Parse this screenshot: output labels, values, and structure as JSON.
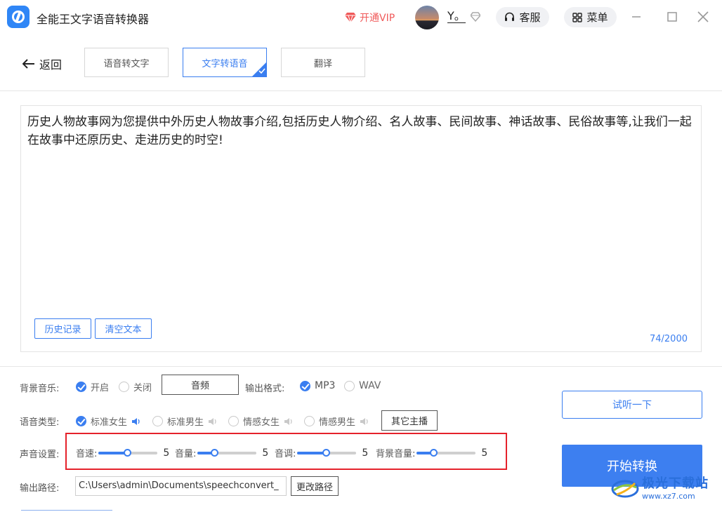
{
  "titlebar": {
    "app_title": "全能王文字语音转换器",
    "vip_label": "开通VIP",
    "user_name": "Y。",
    "service_label": "客服",
    "menu_label": "菜单",
    "icons": {
      "vip": "gem-icon",
      "service": "headset-icon",
      "menu": "grid-icon",
      "minimize": "minimize-icon",
      "maximize": "maximize-icon",
      "close": "close-icon"
    }
  },
  "nav": {
    "back_label": "返回",
    "tabs": [
      {
        "label": "语音转文字",
        "active": false
      },
      {
        "label": "文字转语音",
        "active": true
      },
      {
        "label": "翻译",
        "active": false
      }
    ]
  },
  "editor": {
    "text": "历史人物故事网为您提供中外历史人物故事介绍,包括历史人物介绍、名人故事、民间故事、神话故事、民俗故事等,让我们一起在故事中还原历史、走进历史的时空!",
    "history_button": "历史记录",
    "clear_button": "清空文本",
    "counter": "74/2000"
  },
  "settings": {
    "bg_music": {
      "label": "背景音乐:",
      "on_label": "开启",
      "off_label": "关闭",
      "selected": "on",
      "audio_button": "音频"
    },
    "output_format": {
      "label": "输出格式:",
      "options": [
        "MP3",
        "WAV"
      ],
      "selected": "MP3"
    },
    "voice_type": {
      "label": "语音类型:",
      "options": [
        "标准女生",
        "标准男生",
        "情感女生",
        "情感男生"
      ],
      "selected": "标准女生",
      "other_button": "其它主播"
    },
    "sound": {
      "label": "声音设置:",
      "sliders": [
        {
          "label": "音速:",
          "value": "5",
          "fraction": 0.5
        },
        {
          "label": "音量:",
          "value": "5",
          "fraction": 0.3
        },
        {
          "label": "音调:",
          "value": "5",
          "fraction": 0.5
        },
        {
          "label": "背景音量:",
          "value": "5",
          "fraction": 0.3
        }
      ]
    },
    "output_path": {
      "label": "输出路径:",
      "value": "C:\\Users\\admin\\Documents\\speechconvert_",
      "change_button": "更改路径"
    },
    "preview_button": "试听一下",
    "convert_button": "开始转换"
  },
  "watermark": {
    "main": "极光下载站",
    "sub": "www.xz7.com"
  },
  "colors": {
    "accent": "#3a7ef0",
    "vip": "#f05a5a",
    "highlight": "#e5222b"
  }
}
